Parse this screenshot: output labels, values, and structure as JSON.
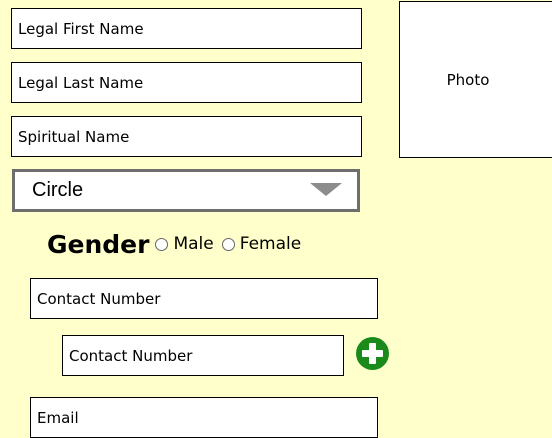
{
  "form": {
    "legal_first_name": "Legal First Name",
    "legal_last_name": "Legal Last Name",
    "spiritual_name": "Spiritual Name",
    "circle_select": {
      "selected": "Circle"
    },
    "gender": {
      "label": "Gender",
      "options": [
        "Male",
        "Female"
      ]
    },
    "contact_number_1": "Contact Number",
    "contact_number_2": "Contact Number",
    "email": "Email"
  },
  "photo": {
    "label": "Photo"
  },
  "icons": {
    "add_contact": "plus-circle-icon",
    "select_arrow": "chevron-down-icon"
  },
  "colors": {
    "background": "#ffffcc",
    "add_button": "#1a8a1a"
  }
}
